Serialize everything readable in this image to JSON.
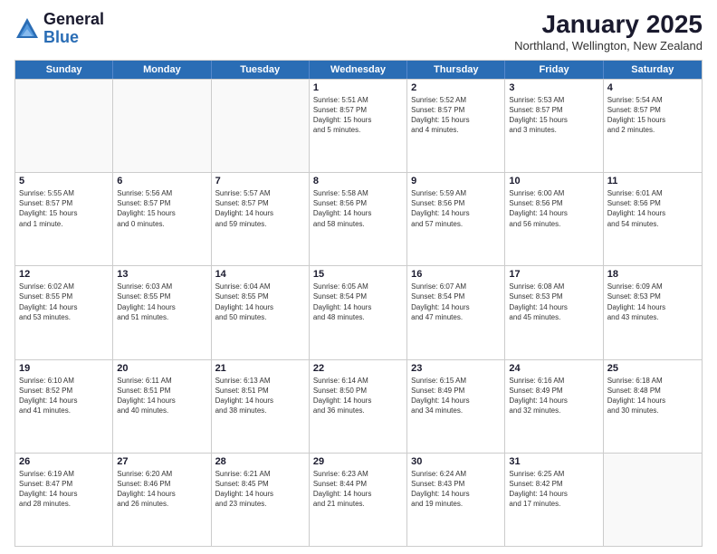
{
  "logo": {
    "general": "General",
    "blue": "Blue"
  },
  "title": "January 2025",
  "location": "Northland, Wellington, New Zealand",
  "weekdays": [
    "Sunday",
    "Monday",
    "Tuesday",
    "Wednesday",
    "Thursday",
    "Friday",
    "Saturday"
  ],
  "weeks": [
    [
      {
        "day": "",
        "info": ""
      },
      {
        "day": "",
        "info": ""
      },
      {
        "day": "",
        "info": ""
      },
      {
        "day": "1",
        "info": "Sunrise: 5:51 AM\nSunset: 8:57 PM\nDaylight: 15 hours\nand 5 minutes."
      },
      {
        "day": "2",
        "info": "Sunrise: 5:52 AM\nSunset: 8:57 PM\nDaylight: 15 hours\nand 4 minutes."
      },
      {
        "day": "3",
        "info": "Sunrise: 5:53 AM\nSunset: 8:57 PM\nDaylight: 15 hours\nand 3 minutes."
      },
      {
        "day": "4",
        "info": "Sunrise: 5:54 AM\nSunset: 8:57 PM\nDaylight: 15 hours\nand 2 minutes."
      }
    ],
    [
      {
        "day": "5",
        "info": "Sunrise: 5:55 AM\nSunset: 8:57 PM\nDaylight: 15 hours\nand 1 minute."
      },
      {
        "day": "6",
        "info": "Sunrise: 5:56 AM\nSunset: 8:57 PM\nDaylight: 15 hours\nand 0 minutes."
      },
      {
        "day": "7",
        "info": "Sunrise: 5:57 AM\nSunset: 8:57 PM\nDaylight: 14 hours\nand 59 minutes."
      },
      {
        "day": "8",
        "info": "Sunrise: 5:58 AM\nSunset: 8:56 PM\nDaylight: 14 hours\nand 58 minutes."
      },
      {
        "day": "9",
        "info": "Sunrise: 5:59 AM\nSunset: 8:56 PM\nDaylight: 14 hours\nand 57 minutes."
      },
      {
        "day": "10",
        "info": "Sunrise: 6:00 AM\nSunset: 8:56 PM\nDaylight: 14 hours\nand 56 minutes."
      },
      {
        "day": "11",
        "info": "Sunrise: 6:01 AM\nSunset: 8:56 PM\nDaylight: 14 hours\nand 54 minutes."
      }
    ],
    [
      {
        "day": "12",
        "info": "Sunrise: 6:02 AM\nSunset: 8:55 PM\nDaylight: 14 hours\nand 53 minutes."
      },
      {
        "day": "13",
        "info": "Sunrise: 6:03 AM\nSunset: 8:55 PM\nDaylight: 14 hours\nand 51 minutes."
      },
      {
        "day": "14",
        "info": "Sunrise: 6:04 AM\nSunset: 8:55 PM\nDaylight: 14 hours\nand 50 minutes."
      },
      {
        "day": "15",
        "info": "Sunrise: 6:05 AM\nSunset: 8:54 PM\nDaylight: 14 hours\nand 48 minutes."
      },
      {
        "day": "16",
        "info": "Sunrise: 6:07 AM\nSunset: 8:54 PM\nDaylight: 14 hours\nand 47 minutes."
      },
      {
        "day": "17",
        "info": "Sunrise: 6:08 AM\nSunset: 8:53 PM\nDaylight: 14 hours\nand 45 minutes."
      },
      {
        "day": "18",
        "info": "Sunrise: 6:09 AM\nSunset: 8:53 PM\nDaylight: 14 hours\nand 43 minutes."
      }
    ],
    [
      {
        "day": "19",
        "info": "Sunrise: 6:10 AM\nSunset: 8:52 PM\nDaylight: 14 hours\nand 41 minutes."
      },
      {
        "day": "20",
        "info": "Sunrise: 6:11 AM\nSunset: 8:51 PM\nDaylight: 14 hours\nand 40 minutes."
      },
      {
        "day": "21",
        "info": "Sunrise: 6:13 AM\nSunset: 8:51 PM\nDaylight: 14 hours\nand 38 minutes."
      },
      {
        "day": "22",
        "info": "Sunrise: 6:14 AM\nSunset: 8:50 PM\nDaylight: 14 hours\nand 36 minutes."
      },
      {
        "day": "23",
        "info": "Sunrise: 6:15 AM\nSunset: 8:49 PM\nDaylight: 14 hours\nand 34 minutes."
      },
      {
        "day": "24",
        "info": "Sunrise: 6:16 AM\nSunset: 8:49 PM\nDaylight: 14 hours\nand 32 minutes."
      },
      {
        "day": "25",
        "info": "Sunrise: 6:18 AM\nSunset: 8:48 PM\nDaylight: 14 hours\nand 30 minutes."
      }
    ],
    [
      {
        "day": "26",
        "info": "Sunrise: 6:19 AM\nSunset: 8:47 PM\nDaylight: 14 hours\nand 28 minutes."
      },
      {
        "day": "27",
        "info": "Sunrise: 6:20 AM\nSunset: 8:46 PM\nDaylight: 14 hours\nand 26 minutes."
      },
      {
        "day": "28",
        "info": "Sunrise: 6:21 AM\nSunset: 8:45 PM\nDaylight: 14 hours\nand 23 minutes."
      },
      {
        "day": "29",
        "info": "Sunrise: 6:23 AM\nSunset: 8:44 PM\nDaylight: 14 hours\nand 21 minutes."
      },
      {
        "day": "30",
        "info": "Sunrise: 6:24 AM\nSunset: 8:43 PM\nDaylight: 14 hours\nand 19 minutes."
      },
      {
        "day": "31",
        "info": "Sunrise: 6:25 AM\nSunset: 8:42 PM\nDaylight: 14 hours\nand 17 minutes."
      },
      {
        "day": "",
        "info": ""
      }
    ]
  ]
}
